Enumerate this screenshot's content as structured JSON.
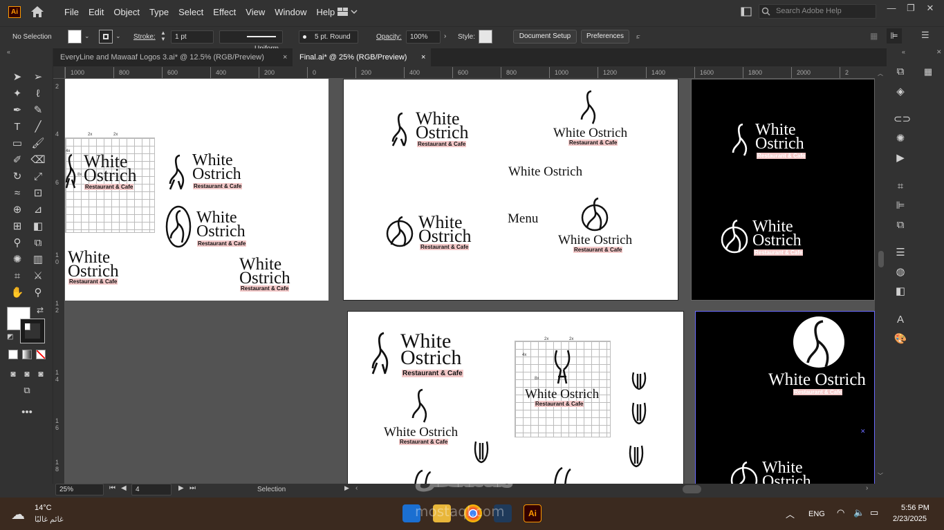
{
  "app": {
    "logo_text": "Ai"
  },
  "menu": [
    "File",
    "Edit",
    "Object",
    "Type",
    "Select",
    "Effect",
    "View",
    "Window",
    "Help"
  ],
  "search": {
    "placeholder": "Search Adobe Help"
  },
  "control": {
    "selection": "No Selection",
    "stroke_label": "Stroke:",
    "stroke_value": "1 pt",
    "stroke_profile": "Uniform",
    "brush": "5 pt. Round",
    "opacity_label": "Opacity:",
    "opacity_value": "100%",
    "style_label": "Style:",
    "document_setup": "Document Setup",
    "preferences": "Preferences"
  },
  "tabs": [
    {
      "label": "EveryLine and Mawaaf Logos 3.ai* @ 12.5% (RGB/Preview)",
      "close": "×"
    },
    {
      "label": "Final.ai* @ 25% (RGB/Preview)",
      "close": "×"
    }
  ],
  "ruler": {
    "top": [
      "1000",
      "800",
      "600",
      "400",
      "200",
      "0",
      "200",
      "400",
      "600",
      "800",
      "1000",
      "1200",
      "1400",
      "1600",
      "1800",
      "2000",
      "2"
    ],
    "left": [
      "2",
      "4",
      "6",
      "1\n0",
      "1\n2",
      "1\n4",
      "1\n6",
      "1\n8"
    ]
  },
  "logo": {
    "white": "White",
    "ostrich": "Ostrich",
    "white_ostrich": "White Ostrich",
    "tagline": "Restaurant & Cafe",
    "menu": "Menu",
    "grid_label_a": "2x",
    "grid_label_b": "4x",
    "grid_label_c": "8x"
  },
  "status": {
    "zoom": "25%",
    "artboard": "4",
    "tool": "Selection"
  },
  "taskbar": {
    "temperature": "14°C",
    "weather": "غائم غالبًا",
    "language": "ENG",
    "time": "5:56 PM",
    "date": "2/23/2025"
  },
  "watermark": {
    "arabic": "مستقل",
    "latin": "mostaql.com"
  },
  "colors": {
    "accent": "#ff9a00",
    "tagline_bg": "#f4c9c9",
    "taskbar": "#3b2a1f"
  }
}
